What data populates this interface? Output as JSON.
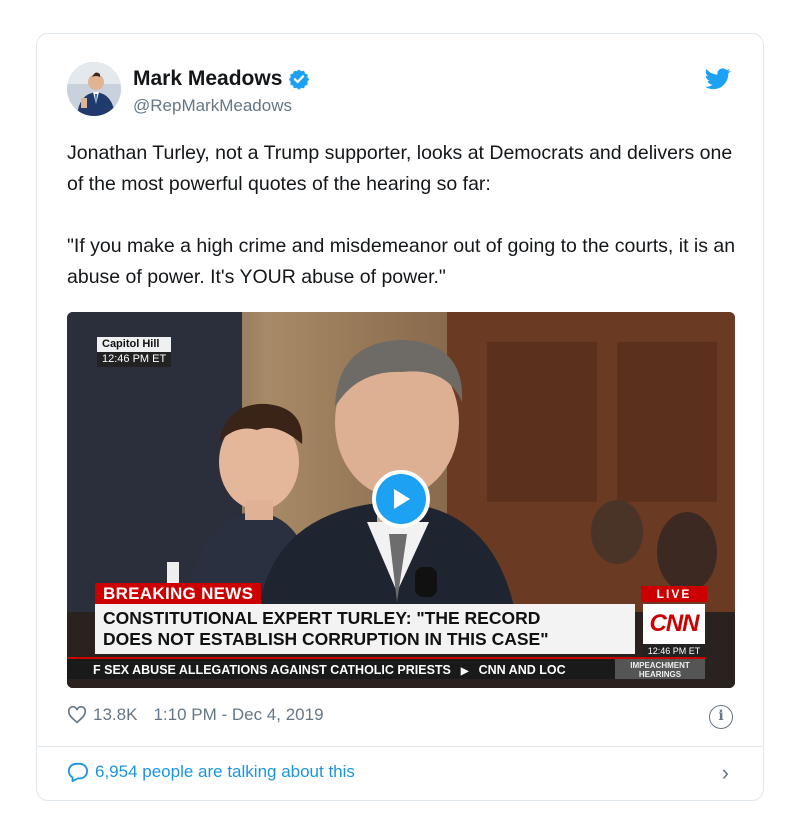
{
  "author": {
    "name": "Mark Meadows",
    "handle": "@RepMarkMeadows",
    "verified": true
  },
  "tweet": {
    "paragraphs": [
      "Jonathan Turley, not a Trump supporter, looks at Democrats and delivers one of the most powerful quotes of the hearing so far:",
      "\"If you make a high crime and misdemeanor out of going to the courts, it is an abuse of power. It's YOUR abuse of power.\""
    ]
  },
  "video": {
    "location_bug": "Capitol Hill",
    "location_time": "12:46 PM ET",
    "breaking_label": "BREAKING NEWS",
    "headline_line1": "CONSTITUTIONAL EXPERT TURLEY: \"THE RECORD",
    "headline_line2": "DOES NOT ESTABLISH CORRUPTION IN THIS CASE\"",
    "live_label": "LIVE",
    "network": "CNN",
    "network_time": "12:46 PM ET",
    "ticker_left": "F SEX ABUSE ALLEGATIONS AGAINST CATHOLIC PRIESTS",
    "ticker_right": "CNN AND LOC",
    "ticker_brand_line1": "IMPEACHMENT",
    "ticker_brand_line2": "HEARINGS"
  },
  "stats": {
    "likes": "13.8K",
    "timestamp": "1:10 PM - Dec 4, 2019"
  },
  "footer": {
    "talking": "6,954 people are talking about this"
  },
  "colors": {
    "twitter_blue": "#1da1f2",
    "link_blue": "#1b95e0",
    "muted": "#657786",
    "cnn_red": "#cc0000"
  },
  "icons": [
    "verified-badge-icon",
    "twitter-bird-icon",
    "play-icon",
    "heart-icon",
    "info-icon",
    "reply-bubble-icon",
    "chevron-right-icon"
  ]
}
